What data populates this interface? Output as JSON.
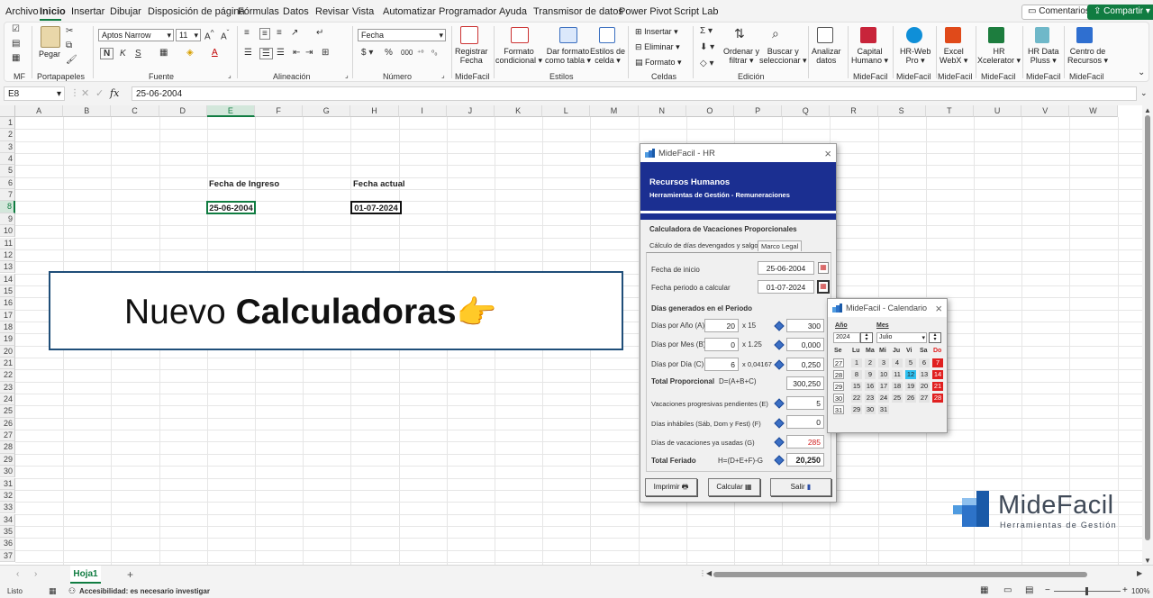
{
  "menu": {
    "items": [
      "Archivo",
      "Inicio",
      "Insertar",
      "Dibujar",
      "Disposición de página",
      "Fórmulas",
      "Datos",
      "Revisar",
      "Vista",
      "Automatizar",
      "Programador",
      "Ayuda",
      "Transmisor de datos",
      "Power Pivot",
      "Script Lab"
    ],
    "comments": "Comentarios",
    "share": "Compartir"
  },
  "ribbon": {
    "groups": {
      "mf": "MF",
      "clipboard": "Portapapeles",
      "font": "Fuente",
      "alignment": "Alineación",
      "number": "Número",
      "midefacil1": "MideFacil",
      "styles": "Estilos",
      "cells": "Celdas",
      "editing": "Edición",
      "midefacil2": "MideFacil",
      "midefacil3": "MideFacil",
      "midefacil4": "MideFacil",
      "midefacil5": "MideFacil",
      "midefacil6": "MideFacil",
      "midefacil7": "MideFacil"
    },
    "paste": "Pegar",
    "font_name": "Aptos Narrow",
    "font_size": "11",
    "number_format": "Fecha",
    "register_1": "Registrar",
    "register_2": "Fecha",
    "cond_format_1": "Formato",
    "cond_format_2": "condicional",
    "table_format_1": "Dar formato",
    "table_format_2": "como tabla",
    "cell_styles_1": "Estilos de",
    "cell_styles_2": "celda",
    "insert": "Insertar",
    "delete": "Eliminar",
    "format": "Formato",
    "sort_1": "Ordenar y",
    "sort_2": "filtrar",
    "find_1": "Buscar y",
    "find_2": "seleccionar",
    "analyze_1": "Analizar",
    "analyze_2": "datos",
    "capital_1": "Capital",
    "capital_2": "Humano",
    "hrweb_1": "HR-Web",
    "hrweb_2": "Pro",
    "excelwebx_1": "Excel",
    "excelwebx_2": "WebX",
    "hrx_1": "HR",
    "hrx_2": "Xcelerator",
    "hrdata_1": "HR Data",
    "hrdata_2": "Pluss",
    "centro_1": "Centro de",
    "centro_2": "Recursos"
  },
  "formula_bar": {
    "name_box": "E8",
    "fx": "fx",
    "value": "25-06-2004"
  },
  "grid": {
    "columns": [
      "A",
      "B",
      "C",
      "D",
      "E",
      "F",
      "G",
      "H",
      "I",
      "J",
      "K",
      "L",
      "M",
      "N",
      "O",
      "P",
      "Q",
      "R",
      "S",
      "T",
      "U",
      "V",
      "W"
    ],
    "rows": [
      "1",
      "2",
      "3",
      "4",
      "5",
      "6",
      "7",
      "8",
      "9",
      "10",
      "11",
      "12",
      "13",
      "14",
      "15",
      "16",
      "17",
      "18",
      "19",
      "20",
      "21",
      "22",
      "23",
      "24",
      "25",
      "26",
      "27",
      "28",
      "29",
      "30",
      "31",
      "32",
      "33",
      "34",
      "35",
      "36",
      "37"
    ],
    "label_ingreso": "Fecha de Ingreso",
    "label_actual": "Fecha actual",
    "value_ingreso": "25-06-2004",
    "value_actual": "01-07-2024"
  },
  "banner": {
    "light": "Nuevo ",
    "bold": "Calculadoras",
    "emoji": "👉"
  },
  "hr_dialog": {
    "title": "MideFacil - HR",
    "header_title": "Recursos Humanos",
    "header_subtitle": "Herramientas de Gestión - Remuneraciones",
    "section": "Calculadora de Vacaciones Proporcionales",
    "tab1": "Cálculo de días devengados y salgo",
    "tab2": "Marco Legal",
    "fecha_inicio_label": "Fecha de inicio",
    "fecha_inicio": "25-06-2004",
    "fecha_periodo_label": "Fecha periodo a calcular",
    "fecha_periodo": "01-07-2024",
    "dias_generados": "Días generados en el Periodo",
    "rows": [
      {
        "label": "Días por Año (A)",
        "qty": "20",
        "factor": "x 15",
        "result": "300"
      },
      {
        "label": "Días por Mes (B)",
        "qty": "0",
        "factor": "x 1.25",
        "result": "0,000"
      },
      {
        "label": "Días por Día (C)",
        "qty": "6",
        "factor": "x 0,04167",
        "result": "0,250"
      }
    ],
    "total_prop_label": "Total Proporcional",
    "total_prop_formula": "D=(A+B+C)",
    "total_prop": "300,250",
    "vac_prog_label": "Vacaciones progresivas pendientes (E)",
    "vac_prog": "5",
    "inhabiles_label": "Días inhábiles (Sáb, Dom y Fest) (F)",
    "inhabiles": "0",
    "usadas_label": "Días de vacaciones ya usadas (G)",
    "usadas": "285",
    "total_feriado_label": "Total Feriado",
    "total_feriado_formula": "H=(D+E+F)-G",
    "total_feriado": "20,250",
    "btn_print": "Imprimir",
    "btn_calc": "Calcular",
    "btn_exit": "Salir"
  },
  "calendar": {
    "title": "MideFacil - Calendario",
    "year_label": "Año",
    "month_label": "Mes",
    "year": "2024",
    "month": "Julio",
    "weekdays": [
      "Se",
      "Lu",
      "Ma",
      "Mi",
      "Ju",
      "Vi",
      "Sa",
      "Do"
    ],
    "weeks": [
      {
        "wk": "27",
        "days": [
          "1",
          "2",
          "3",
          "4",
          "5",
          "6",
          "7"
        ]
      },
      {
        "wk": "28",
        "days": [
          "8",
          "9",
          "10",
          "11",
          "12",
          "13",
          "14"
        ]
      },
      {
        "wk": "29",
        "days": [
          "15",
          "16",
          "17",
          "18",
          "19",
          "20",
          "21"
        ]
      },
      {
        "wk": "30",
        "days": [
          "22",
          "23",
          "24",
          "25",
          "26",
          "27",
          "28"
        ]
      },
      {
        "wk": "31",
        "days": [
          "29",
          "30",
          "31",
          "",
          "",
          "",
          ""
        ]
      }
    ],
    "today": "12",
    "sunday_color": "#e02020",
    "today_color": "#2ec0f0"
  },
  "logo": {
    "name": "MideFacil",
    "tagline": "Herramientas de Gestión"
  },
  "sheet_tab": "Hoja1",
  "status": {
    "ready": "Listo",
    "accessibility": "Accesibilidad: es necesario investigar",
    "zoom": "100%"
  },
  "colors": {
    "excel_green": "#107c41",
    "banner_border": "#1f4e79",
    "dialog_header": "#1b2f91",
    "red_value": "#d02020"
  }
}
